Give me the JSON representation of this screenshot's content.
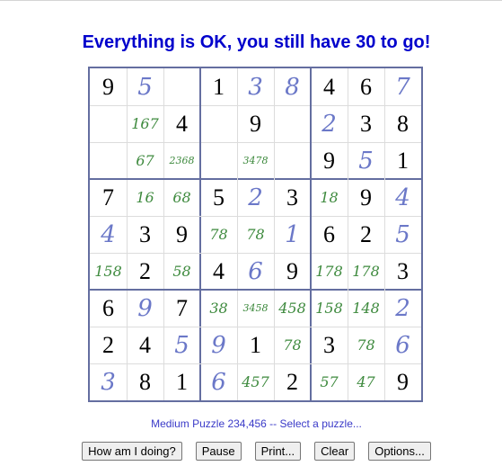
{
  "status_message": "Everything is OK, you still have 30 to go!",
  "grid": [
    [
      {
        "v": "9",
        "t": "given"
      },
      {
        "v": "5",
        "t": "solved"
      },
      {
        "v": "",
        "t": "empty"
      },
      {
        "v": "1",
        "t": "given"
      },
      {
        "v": "3",
        "t": "solved"
      },
      {
        "v": "8",
        "t": "solved"
      },
      {
        "v": "4",
        "t": "given"
      },
      {
        "v": "6",
        "t": "given"
      },
      {
        "v": "7",
        "t": "solved"
      }
    ],
    [
      {
        "v": "",
        "t": "empty"
      },
      {
        "v": "167",
        "t": "cand"
      },
      {
        "v": "4",
        "t": "given"
      },
      {
        "v": "",
        "t": "empty"
      },
      {
        "v": "9",
        "t": "given"
      },
      {
        "v": "",
        "t": "empty"
      },
      {
        "v": "2",
        "t": "solved"
      },
      {
        "v": "3",
        "t": "given"
      },
      {
        "v": "8",
        "t": "given"
      }
    ],
    [
      {
        "v": "",
        "t": "empty"
      },
      {
        "v": "67",
        "t": "cand"
      },
      {
        "v": "2368",
        "t": "cand"
      },
      {
        "v": "",
        "t": "empty"
      },
      {
        "v": "3478",
        "t": "cand"
      },
      {
        "v": "",
        "t": "empty"
      },
      {
        "v": "9",
        "t": "given"
      },
      {
        "v": "5",
        "t": "solved"
      },
      {
        "v": "1",
        "t": "given"
      }
    ],
    [
      {
        "v": "7",
        "t": "given"
      },
      {
        "v": "16",
        "t": "cand"
      },
      {
        "v": "68",
        "t": "cand"
      },
      {
        "v": "5",
        "t": "given"
      },
      {
        "v": "2",
        "t": "solved"
      },
      {
        "v": "3",
        "t": "given"
      },
      {
        "v": "18",
        "t": "cand"
      },
      {
        "v": "9",
        "t": "given"
      },
      {
        "v": "4",
        "t": "solved"
      }
    ],
    [
      {
        "v": "4",
        "t": "solved"
      },
      {
        "v": "3",
        "t": "given"
      },
      {
        "v": "9",
        "t": "given"
      },
      {
        "v": "78",
        "t": "cand"
      },
      {
        "v": "78",
        "t": "cand"
      },
      {
        "v": "1",
        "t": "solved"
      },
      {
        "v": "6",
        "t": "given"
      },
      {
        "v": "2",
        "t": "given"
      },
      {
        "v": "5",
        "t": "solved"
      }
    ],
    [
      {
        "v": "158",
        "t": "cand"
      },
      {
        "v": "2",
        "t": "given"
      },
      {
        "v": "58",
        "t": "cand"
      },
      {
        "v": "4",
        "t": "given"
      },
      {
        "v": "6",
        "t": "solved"
      },
      {
        "v": "9",
        "t": "given"
      },
      {
        "v": "178",
        "t": "cand"
      },
      {
        "v": "178",
        "t": "cand"
      },
      {
        "v": "3",
        "t": "given"
      }
    ],
    [
      {
        "v": "6",
        "t": "given"
      },
      {
        "v": "9",
        "t": "solved"
      },
      {
        "v": "7",
        "t": "given"
      },
      {
        "v": "38",
        "t": "cand"
      },
      {
        "v": "3458",
        "t": "cand"
      },
      {
        "v": "458",
        "t": "cand"
      },
      {
        "v": "158",
        "t": "cand"
      },
      {
        "v": "148",
        "t": "cand"
      },
      {
        "v": "2",
        "t": "solved"
      }
    ],
    [
      {
        "v": "2",
        "t": "given"
      },
      {
        "v": "4",
        "t": "given"
      },
      {
        "v": "5",
        "t": "solved"
      },
      {
        "v": "9",
        "t": "solved"
      },
      {
        "v": "1",
        "t": "given"
      },
      {
        "v": "78",
        "t": "cand"
      },
      {
        "v": "3",
        "t": "given"
      },
      {
        "v": "78",
        "t": "cand"
      },
      {
        "v": "6",
        "t": "solved"
      }
    ],
    [
      {
        "v": "3",
        "t": "solved"
      },
      {
        "v": "8",
        "t": "given"
      },
      {
        "v": "1",
        "t": "given"
      },
      {
        "v": "6",
        "t": "solved"
      },
      {
        "v": "457",
        "t": "cand"
      },
      {
        "v": "2",
        "t": "given"
      },
      {
        "v": "57",
        "t": "cand"
      },
      {
        "v": "47",
        "t": "cand"
      },
      {
        "v": "9",
        "t": "given"
      }
    ]
  ],
  "colors": {
    "given": "#000000",
    "solved": "#6b78c8",
    "candidate": "#3e8a3e",
    "box_border": "#646ea0",
    "cell_border": "#dcdcdc",
    "status": "#0000cc",
    "link": "#3a3ac8"
  },
  "footer": {
    "puzzle_label": "Medium Puzzle 234,456 -- Select a puzzle..."
  },
  "buttons": {
    "how_am_i_doing": "How am I doing?",
    "pause": "Pause",
    "print": "Print...",
    "clear": "Clear",
    "options": "Options..."
  }
}
